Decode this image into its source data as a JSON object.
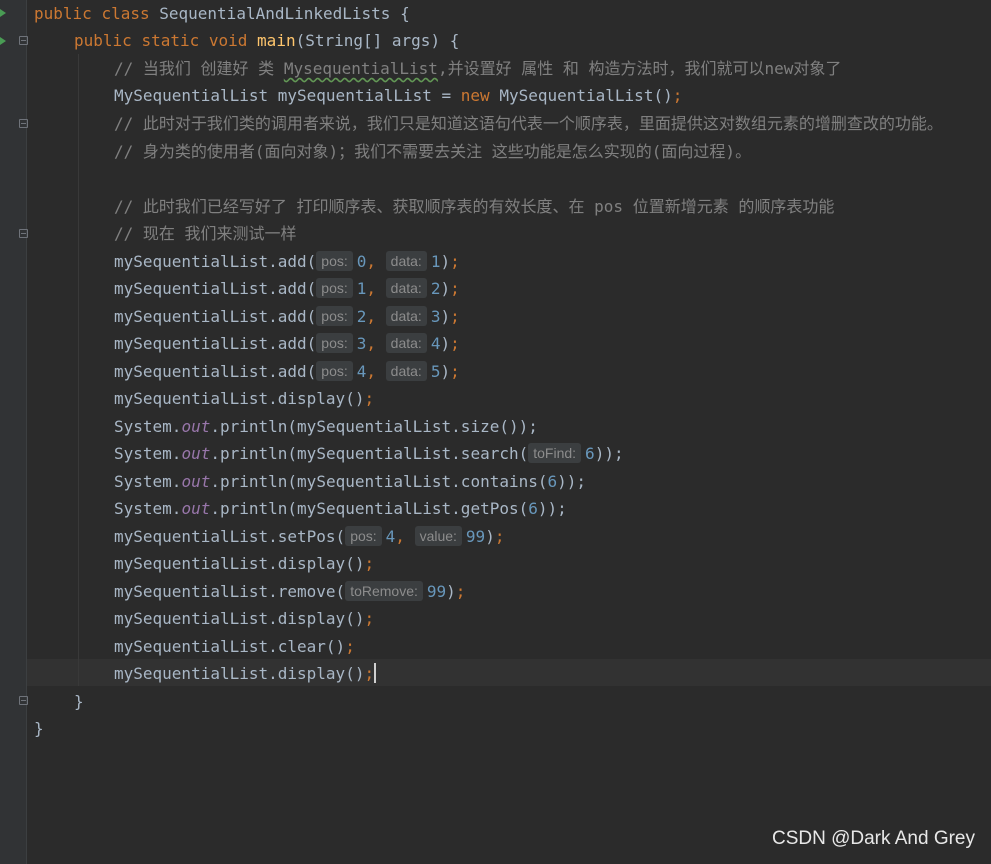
{
  "code": {
    "class_decl": {
      "kw1": "public",
      "kw2": "class",
      "name": "SequentialAndLinkedLists",
      "brace": " {"
    },
    "main_decl": {
      "kw1": "public",
      "kw2": "static",
      "kw3": "void",
      "name": "main",
      "params": "(String[] args) {"
    },
    "comment1_a": "// 当我们 创建好 类 ",
    "comment1_class": "MysequentialList",
    "comment1_b": ",并设置好 属性 和 构造方法时，我们就可以new对象了",
    "decl_line": {
      "type": "MySequentialList mySequentialList = ",
      "kw": "new",
      "ctor": " MySequentialList()",
      "semi": ";"
    },
    "comment2": "// 此时对于我们类的调用者来说，我们只是知道这语句代表一个顺序表，里面提供这对数组元素的增删查改的功能。",
    "comment3": "// 身为类的使用者(面向对象)；我们不需要去关注 这些功能是怎么实现的(面向过程)。",
    "comment4": "// 此时我们已经写好了 打印顺序表、获取顺序表的有效长度、在 pos 位置新增元素 的顺序表功能",
    "comment5": "// 现在 我们来测试一样",
    "add_calls": [
      {
        "prefix": "mySequentialList.add(",
        "hint1": "pos:",
        "v1": "0",
        "hint2": "data:",
        "v2": "1"
      },
      {
        "prefix": "mySequentialList.add(",
        "hint1": "pos:",
        "v1": "1",
        "hint2": "data:",
        "v2": "2"
      },
      {
        "prefix": "mySequentialList.add(",
        "hint1": "pos:",
        "v1": "2",
        "hint2": "data:",
        "v2": "3"
      },
      {
        "prefix": "mySequentialList.add(",
        "hint1": "pos:",
        "v1": "3",
        "hint2": "data:",
        "v2": "4"
      },
      {
        "prefix": "mySequentialList.add(",
        "hint1": "pos:",
        "v1": "4",
        "hint2": "data:",
        "v2": "5"
      }
    ],
    "display_call": "mySequentialList.display()",
    "semi": ";",
    "close_paren_semi": ");",
    "comma": ", ",
    "system": "System.",
    "out": "out",
    "println_open": ".println(",
    "println_size": "mySequentialList.size());",
    "println_search_prefix": "mySequentialList.search(",
    "search_hint": "toFind:",
    "search_val": "6",
    "double_close": "));",
    "println_contains_prefix": "mySequentialList.contains(",
    "println_getpos_prefix": "mySequentialList.getPos(",
    "setpos_prefix": "mySequentialList.setPos(",
    "setpos_hint1": "pos:",
    "setpos_v1": "4",
    "setpos_hint2": "value:",
    "setpos_v2": "99",
    "remove_prefix": "mySequentialList.remove(",
    "remove_hint": "toRemove:",
    "remove_val": "99",
    "clear_call": "mySequentialList.clear()",
    "close_brace": "}",
    "contains_val": "6",
    "getpos_val": "6"
  },
  "watermark": "CSDN @Dark And Grey",
  "colors": {
    "background": "#2b2b2b",
    "keyword": "#cc7832",
    "method": "#ffc66d",
    "comment": "#808080",
    "number": "#6897bb",
    "field": "#9876aa",
    "text": "#a9b7c6"
  }
}
